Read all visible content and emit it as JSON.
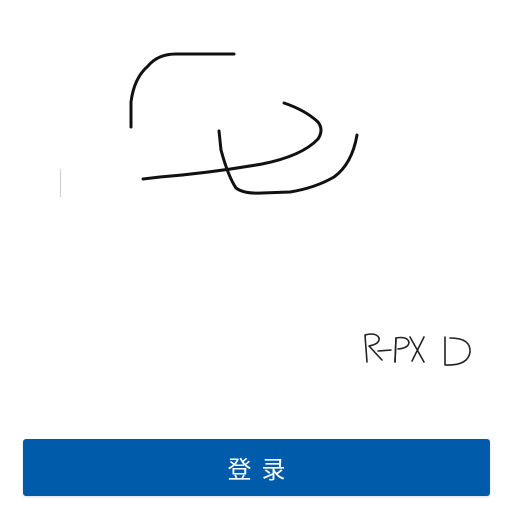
{
  "captcha": {
    "text": "R-PXD"
  },
  "login_button": {
    "label": "登录"
  },
  "colors": {
    "button_bg": "#005baa",
    "button_text": "#ffffff",
    "ink": "#111111"
  }
}
